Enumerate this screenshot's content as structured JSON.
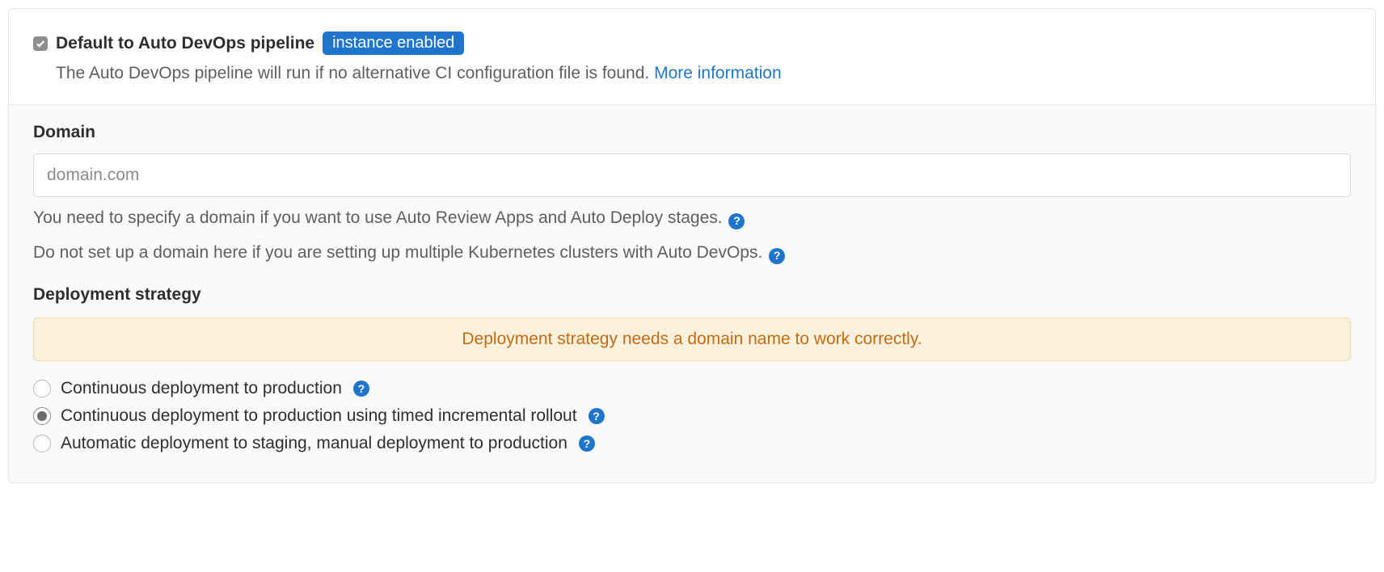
{
  "header": {
    "checkbox_label": "Default to Auto DevOps pipeline",
    "badge": "instance enabled",
    "description": "The Auto DevOps pipeline will run if no alternative CI configuration file is found.",
    "more_link": "More information"
  },
  "domain": {
    "title": "Domain",
    "placeholder": "domain.com",
    "value": "",
    "help1": "You need to specify a domain if you want to use Auto Review Apps and Auto Deploy stages.",
    "help2": "Do not set up a domain here if you are setting up multiple Kubernetes clusters with Auto DevOps."
  },
  "strategy": {
    "title": "Deployment strategy",
    "warning": "Deployment strategy needs a domain name to work correctly.",
    "options": [
      {
        "label": "Continuous deployment to production",
        "selected": false
      },
      {
        "label": "Continuous deployment to production using timed incremental rollout",
        "selected": true
      },
      {
        "label": "Automatic deployment to staging, manual deployment to production",
        "selected": false
      }
    ]
  }
}
